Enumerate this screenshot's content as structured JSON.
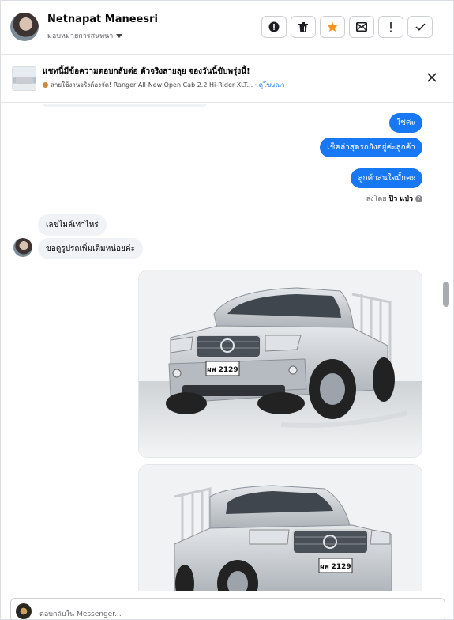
{
  "header": {
    "contact_name": "Netnapat Maneesri",
    "assign_label": "มอบหมายการสนทนา",
    "toolbar": [
      {
        "name": "report-spam-button",
        "icon": "alert-circle-icon"
      },
      {
        "name": "delete-button",
        "icon": "trash-icon"
      },
      {
        "name": "star-button",
        "icon": "star-icon"
      },
      {
        "name": "mark-unread-button",
        "icon": "envelope-icon"
      },
      {
        "name": "follow-up-button",
        "icon": "exclamation-icon"
      },
      {
        "name": "mark-done-button",
        "icon": "check-icon"
      }
    ]
  },
  "ad": {
    "title": "แชทนี้มีข้อความตอบกลับต่อ ตัวจริงสายลุย จองวันนี้ขับพรุ่งนี้!",
    "subtitle": "สายใช้งานจริงต้องจัด! Ranger All-New Open Cab 2.2 Hi-Rider XLT...",
    "link": "ดูโฆษณา"
  },
  "messages": {
    "out": [
      "ใช่ค่ะ",
      "เช็คล่าสุดรถยังอยู่ค่ะลูกค้า",
      "ลูกค้าสนใจมั้ยคะ"
    ],
    "sent_by_prefix": "ส่งโดย",
    "sent_by_name": "ป๊ว แป่ว",
    "sent_by_help": "?",
    "in": [
      "เลขไมล์เท่าไหร่",
      "ขอดูรูปรถเพิ่มเติมหน่อยค่ะ"
    ],
    "plates": [
      "ผพ 2129",
      "ผพ 2129"
    ]
  },
  "composer": {
    "placeholder": "ตอบกลับใน Messenger..."
  },
  "colors": {
    "accent": "#1877f2",
    "star": "#f7931e",
    "bubble_in": "#f0f2f5"
  }
}
